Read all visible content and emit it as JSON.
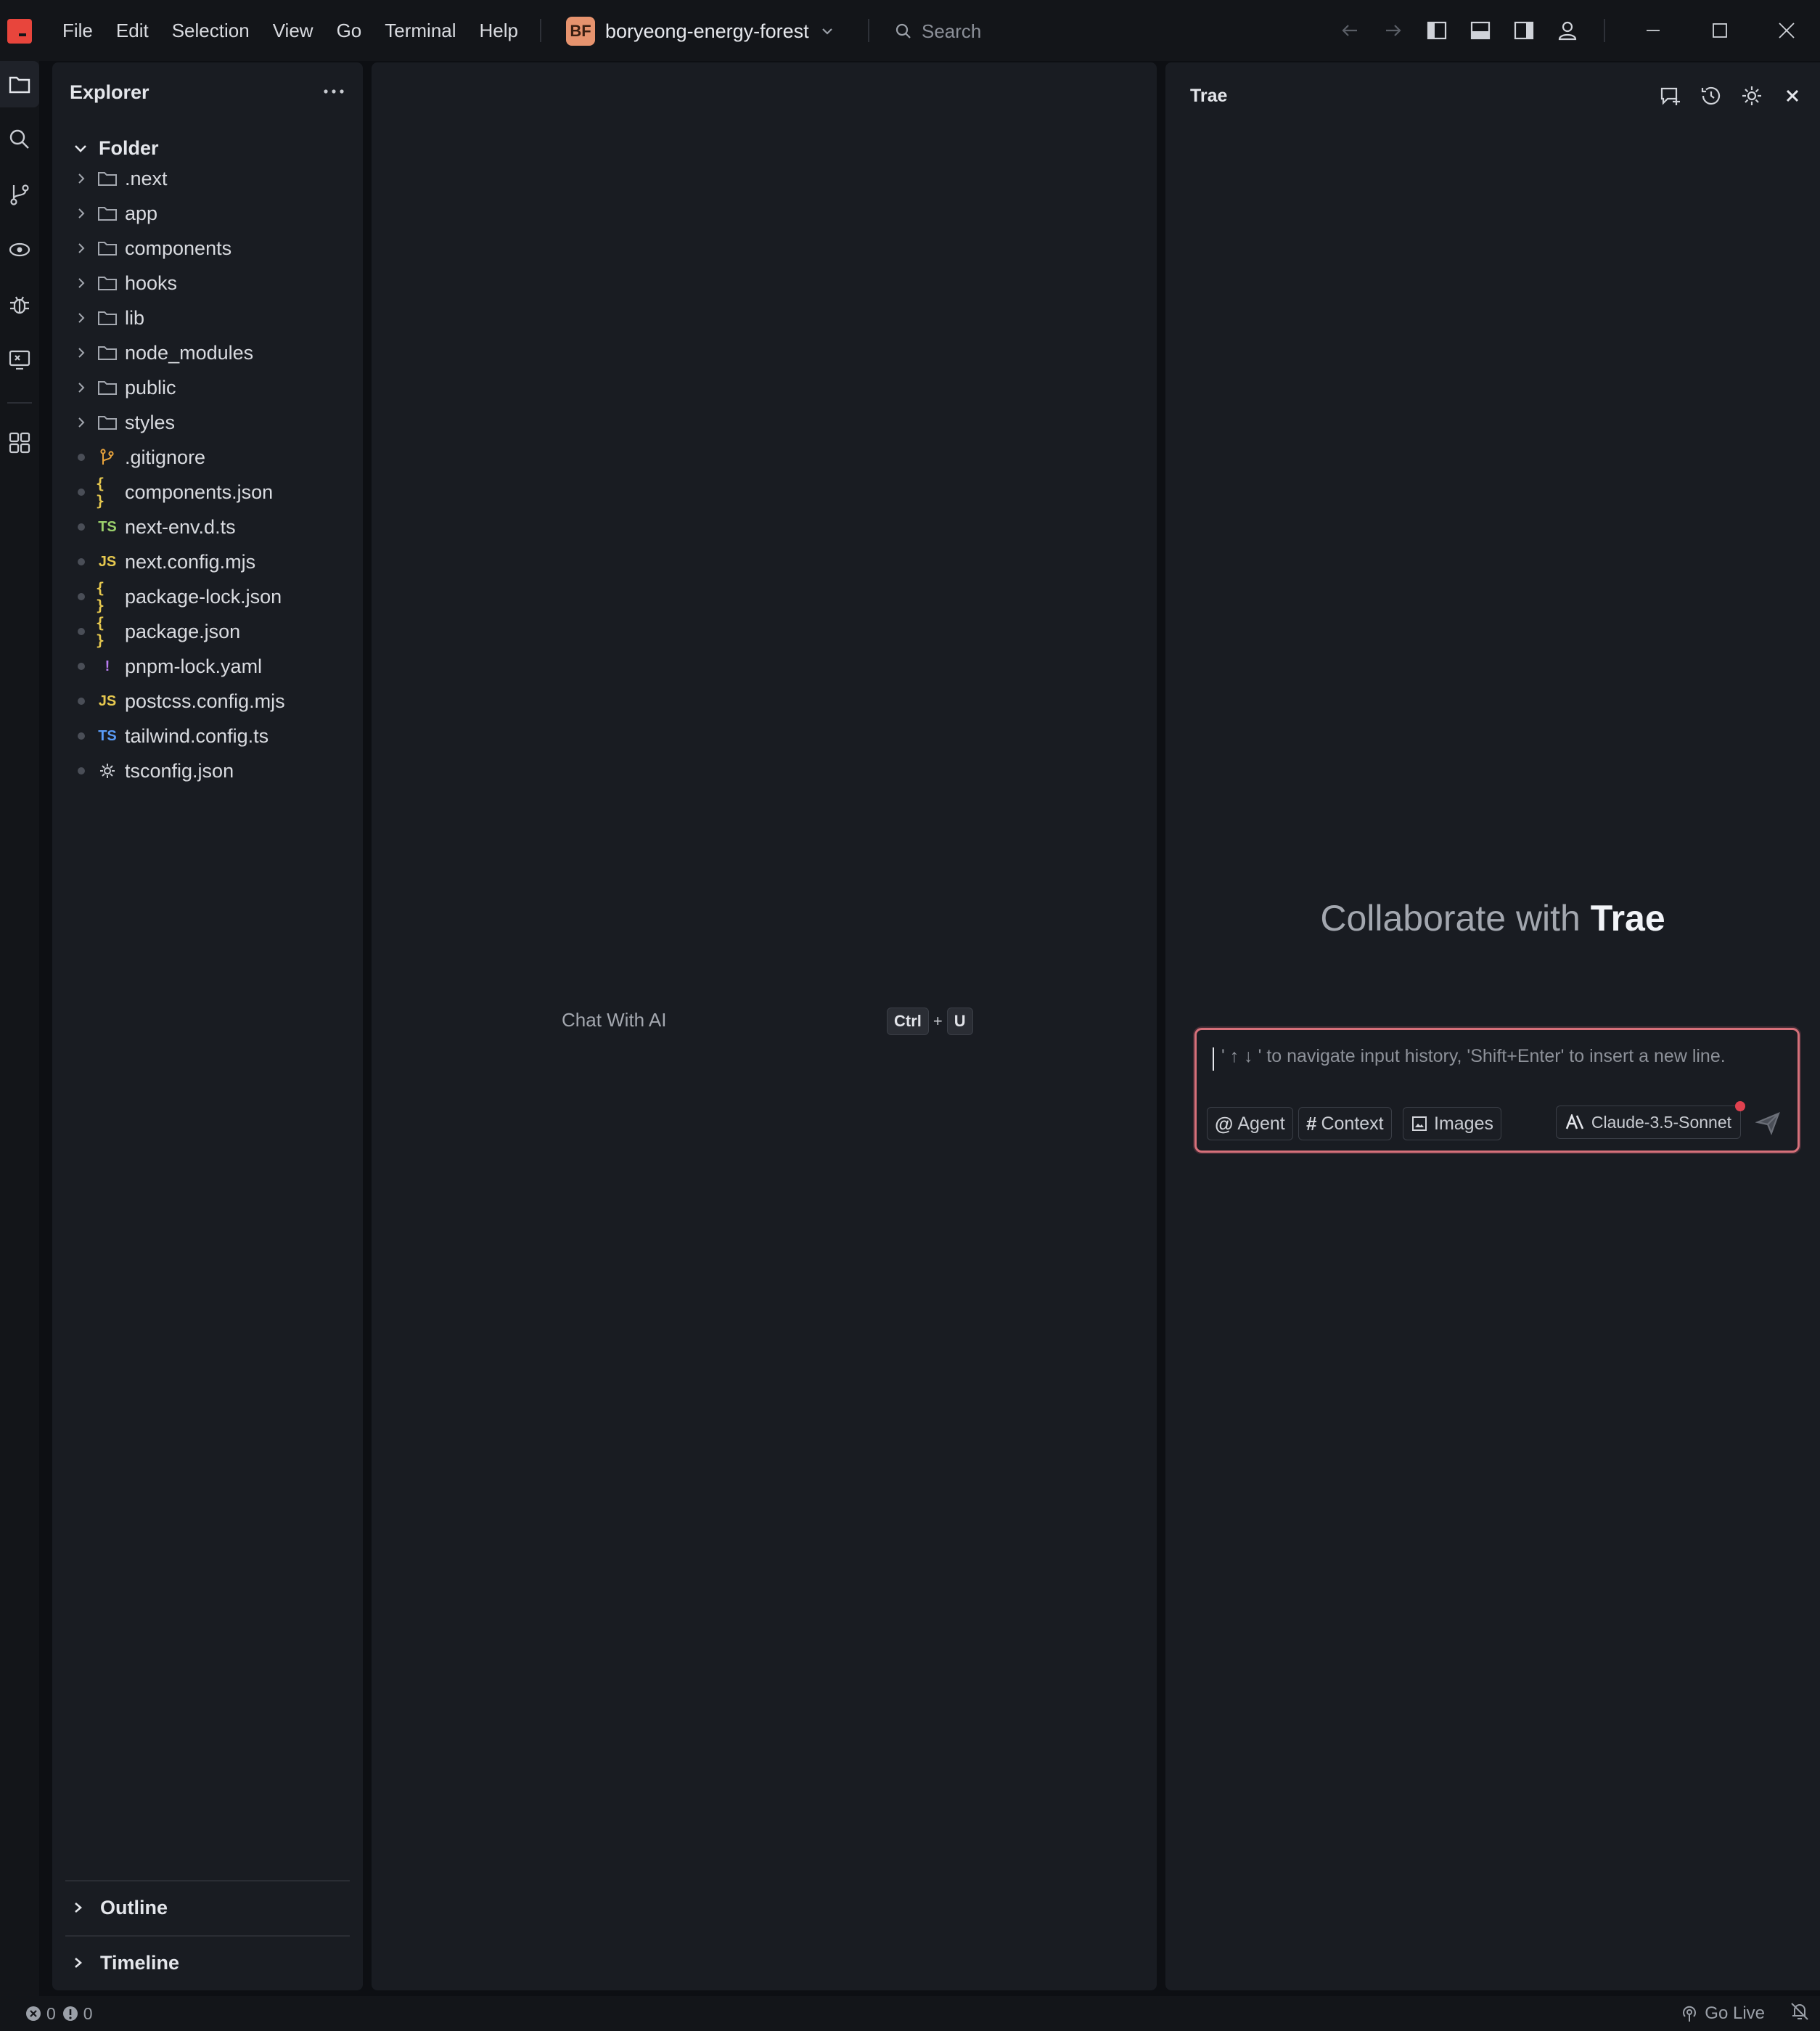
{
  "menu": [
    "File",
    "Edit",
    "Selection",
    "View",
    "Go",
    "Terminal",
    "Help"
  ],
  "project": {
    "initials": "BF",
    "name": "boryeong-energy-forest",
    "avatar_color": "#e6936e"
  },
  "search": {
    "placeholder": "Search"
  },
  "explorer": {
    "title": "Explorer",
    "folder_label": "Folder",
    "items": [
      {
        "name": ".next",
        "kind": "folder"
      },
      {
        "name": "app",
        "kind": "folder"
      },
      {
        "name": "components",
        "kind": "folder"
      },
      {
        "name": "hooks",
        "kind": "folder"
      },
      {
        "name": "lib",
        "kind": "folder"
      },
      {
        "name": "node_modules",
        "kind": "folder"
      },
      {
        "name": "public",
        "kind": "folder"
      },
      {
        "name": "styles",
        "kind": "folder"
      },
      {
        "name": ".gitignore",
        "kind": "git"
      },
      {
        "name": "components.json",
        "kind": "json",
        "badge": "{ }"
      },
      {
        "name": "next-env.d.ts",
        "kind": "ts-green",
        "badge": "TS"
      },
      {
        "name": "next.config.mjs",
        "kind": "js",
        "badge": "JS"
      },
      {
        "name": "package-lock.json",
        "kind": "json",
        "badge": "{ }"
      },
      {
        "name": "package.json",
        "kind": "json",
        "badge": "{ }"
      },
      {
        "name": "pnpm-lock.yaml",
        "kind": "yaml",
        "badge": "!"
      },
      {
        "name": "postcss.config.mjs",
        "kind": "js",
        "badge": "JS"
      },
      {
        "name": "tailwind.config.ts",
        "kind": "ts",
        "badge": "TS"
      },
      {
        "name": "tsconfig.json",
        "kind": "gear"
      }
    ],
    "outline_label": "Outline",
    "timeline_label": "Timeline"
  },
  "editor": {
    "chat_hint": "Chat With AI",
    "shortcut": {
      "key1": "Ctrl",
      "plus": "+",
      "key2": "U"
    }
  },
  "trae": {
    "title": "Trae",
    "collab_prefix": "Collaborate with",
    "collab_name": "Trae",
    "input_placeholder": "' ↑ ↓ ' to navigate input history, 'Shift+Enter' to insert a new line.",
    "chips": {
      "agent": "Agent",
      "context": "Context",
      "images": "Images"
    },
    "model": "Claude-3.5-Sonnet",
    "accent_color": "#d6707a"
  },
  "status": {
    "errors": "0",
    "warnings": "0",
    "go_live": "Go Live"
  },
  "colors": {
    "logo": "#e8453c",
    "background": "#0d0f13",
    "panel": "#191c22"
  }
}
